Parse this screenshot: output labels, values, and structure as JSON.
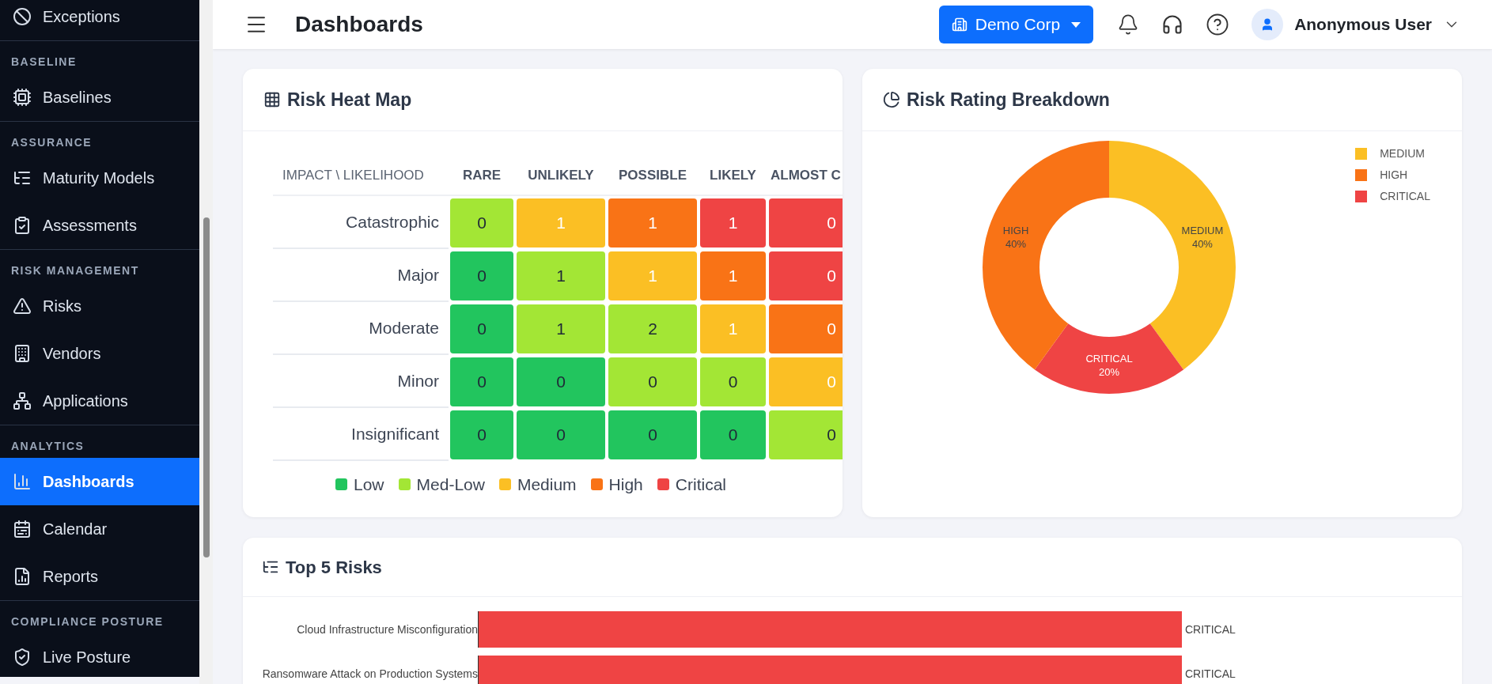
{
  "sidebar": {
    "sections": [
      {
        "items": [
          {
            "label": "Exceptions",
            "selected": false
          }
        ]
      },
      {
        "title": "BASELINE",
        "items": [
          {
            "label": "Baselines",
            "selected": false
          }
        ]
      },
      {
        "title": "ASSURANCE",
        "items": [
          {
            "label": "Maturity Models",
            "selected": false
          },
          {
            "label": "Assessments",
            "selected": false
          }
        ]
      },
      {
        "title": "RISK MANAGEMENT",
        "items": [
          {
            "label": "Risks",
            "selected": false
          },
          {
            "label": "Vendors",
            "selected": false
          },
          {
            "label": "Applications",
            "selected": false
          }
        ]
      },
      {
        "title": "ANALYTICS",
        "items": [
          {
            "label": "Dashboards",
            "selected": true
          },
          {
            "label": "Calendar",
            "selected": false
          },
          {
            "label": "Reports",
            "selected": false
          }
        ]
      },
      {
        "title": "COMPLIANCE POSTURE",
        "items": [
          {
            "label": "Live Posture",
            "selected": false
          }
        ]
      }
    ]
  },
  "header": {
    "title": "Dashboards",
    "org_button": "Demo Corp",
    "user": "Anonymous User"
  },
  "heat_map": {
    "title": "Risk Heat Map",
    "corner": "IMPACT \\ LIKELIHOOD",
    "columns": [
      "RARE",
      "UNLIKELY",
      "POSSIBLE",
      "LIKELY",
      "ALMOST C"
    ],
    "rows": [
      {
        "label": "Catastrophic",
        "cells": [
          {
            "value": "0",
            "color": "#a3e635"
          },
          {
            "value": "1",
            "color": "#fbbf24"
          },
          {
            "value": "1",
            "color": "#f97316"
          },
          {
            "value": "1",
            "color": "#ef4444"
          },
          {
            "value": "0",
            "color": "#ef4444"
          }
        ]
      },
      {
        "label": "Major",
        "cells": [
          {
            "value": "0",
            "color": "#22c55e"
          },
          {
            "value": "1",
            "color": "#a3e635"
          },
          {
            "value": "1",
            "color": "#fbbf24"
          },
          {
            "value": "1",
            "color": "#f97316"
          },
          {
            "value": "0",
            "color": "#ef4444"
          }
        ]
      },
      {
        "label": "Moderate",
        "cells": [
          {
            "value": "0",
            "color": "#22c55e"
          },
          {
            "value": "1",
            "color": "#a3e635"
          },
          {
            "value": "2",
            "color": "#a3e635"
          },
          {
            "value": "1",
            "color": "#fbbf24"
          },
          {
            "value": "0",
            "color": "#f97316"
          }
        ]
      },
      {
        "label": "Minor",
        "cells": [
          {
            "value": "0",
            "color": "#22c55e"
          },
          {
            "value": "0",
            "color": "#22c55e"
          },
          {
            "value": "0",
            "color": "#a3e635"
          },
          {
            "value": "0",
            "color": "#a3e635"
          },
          {
            "value": "0",
            "color": "#fbbf24"
          }
        ]
      },
      {
        "label": "Insignificant",
        "cells": [
          {
            "value": "0",
            "color": "#22c55e"
          },
          {
            "value": "0",
            "color": "#22c55e"
          },
          {
            "value": "0",
            "color": "#22c55e"
          },
          {
            "value": "0",
            "color": "#22c55e"
          },
          {
            "value": "0",
            "color": "#a3e635"
          }
        ]
      }
    ],
    "legend": [
      {
        "label": "Low",
        "color": "#22c55e"
      },
      {
        "label": "Med-Low",
        "color": "#a3e635"
      },
      {
        "label": "Medium",
        "color": "#fbbf24"
      },
      {
        "label": "High",
        "color": "#f97316"
      },
      {
        "label": "Critical",
        "color": "#ef4444"
      }
    ]
  },
  "breakdown": {
    "title": "Risk Rating Breakdown",
    "legend": [
      {
        "label": "MEDIUM",
        "color": "#fbbf24"
      },
      {
        "label": "HIGH",
        "color": "#f97316"
      },
      {
        "label": "CRITICAL",
        "color": "#ef4444"
      }
    ],
    "chart_data": {
      "type": "donut",
      "categories": [
        "MEDIUM",
        "CRITICAL",
        "HIGH"
      ],
      "values": [
        40,
        20,
        40
      ],
      "colors": [
        "#fbbf24",
        "#ef4444",
        "#f97316"
      ],
      "value_labels": [
        "40%",
        "20%",
        "40%"
      ]
    }
  },
  "top_risks": {
    "title": "Top 5 Risks",
    "risks": [
      {
        "name": "Cloud Infrastructure Misconfiguration",
        "rating": "CRITICAL",
        "level": 1
      },
      {
        "name": "Ransomware Attack on Production Systems",
        "rating": "CRITICAL",
        "level": 1
      }
    ]
  }
}
